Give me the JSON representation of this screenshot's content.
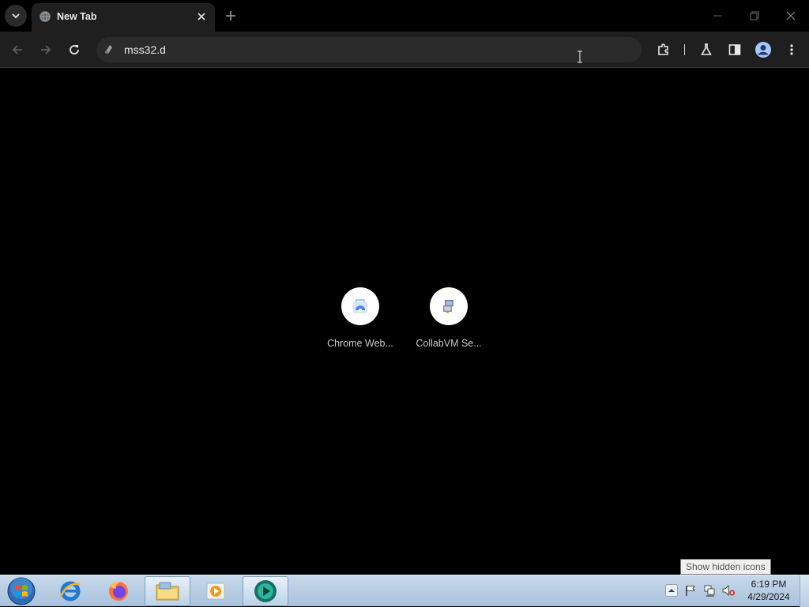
{
  "browser": {
    "tab": {
      "title": "New Tab"
    },
    "omnibox": {
      "value": "mss32.d"
    },
    "colors": {
      "frame": "#000000",
      "toolbar": "#1f1f1f",
      "omnibox": "#2b2b2b"
    }
  },
  "ntp": {
    "shortcuts": [
      {
        "label": "Chrome Web...",
        "icon": "chrome-web-store-icon"
      },
      {
        "label": "CollabVM Se...",
        "icon": "collabvm-icon"
      }
    ]
  },
  "taskbar": {
    "apps": [
      {
        "name": "internet-explorer-icon"
      },
      {
        "name": "firefox-icon"
      },
      {
        "name": "windows-explorer-icon"
      },
      {
        "name": "media-player-icon"
      },
      {
        "name": "chrome-app-icon",
        "active": true
      }
    ],
    "clock": {
      "time": "6:19 PM",
      "date": "4/29/2024"
    },
    "tooltip": "Show hidden icons"
  }
}
